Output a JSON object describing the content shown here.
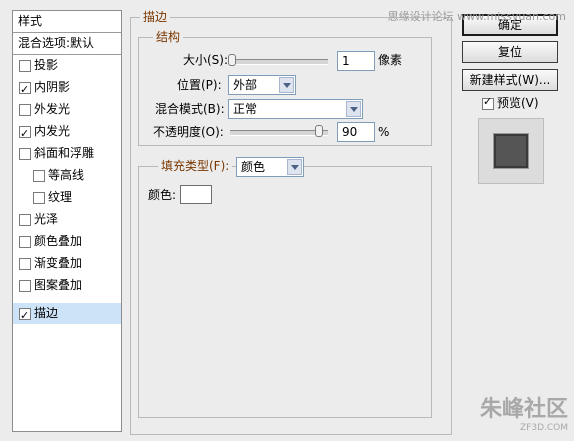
{
  "sidebar": {
    "header": "样式",
    "blend_options": "混合选项:默认",
    "items": [
      {
        "label": "投影",
        "checked": false
      },
      {
        "label": "内阴影",
        "checked": true
      },
      {
        "label": "外发光",
        "checked": false
      },
      {
        "label": "内发光",
        "checked": true
      },
      {
        "label": "斜面和浮雕",
        "checked": false
      },
      {
        "label": "等高线",
        "checked": false
      },
      {
        "label": "纹理",
        "checked": false
      },
      {
        "label": "光泽",
        "checked": false
      },
      {
        "label": "颜色叠加",
        "checked": false
      },
      {
        "label": "渐变叠加",
        "checked": false
      },
      {
        "label": "图案叠加",
        "checked": false
      },
      {
        "label": "描边",
        "checked": true,
        "selected": true
      }
    ]
  },
  "stroke": {
    "group_title": "描边",
    "structure_title": "结构",
    "size_label": "大小(S):",
    "size_value": "1",
    "size_unit": "像素",
    "position_label": "位置(P):",
    "position_value": "外部",
    "blend_label": "混合模式(B):",
    "blend_value": "正常",
    "opacity_label": "不透明度(O):",
    "opacity_value": "90",
    "opacity_unit": "%",
    "fill_type_label": "填充类型(F):",
    "fill_type_value": "颜色",
    "color_label": "颜色:",
    "color_value": "#ffffff"
  },
  "buttons": {
    "ok": "确定",
    "reset": "复位",
    "new_style": "新建样式(W)...",
    "preview": "预览(V)"
  },
  "preview_checked": true,
  "watermarks": {
    "top_right": "思缘设计论坛 www.missyuan.com",
    "bottom_right": "朱峰社区",
    "bottom_right_small": "ZF3D.COM"
  }
}
